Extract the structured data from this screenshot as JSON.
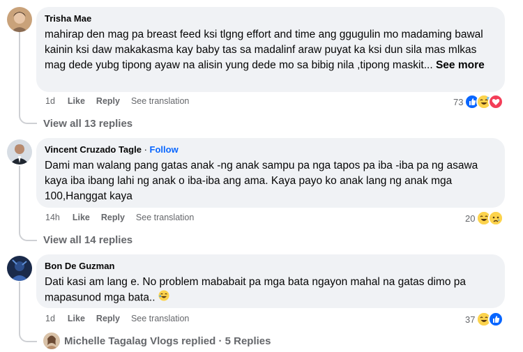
{
  "comments": [
    {
      "author": "Trisha Mae",
      "text": "mahirap den mag pa breast feed ksi tlgng effort and time ang ggugulin mo madaming bawal kainin ksi daw makakasma kay baby tas sa madalinf araw puyat ka ksi dun sila mas mlkas mag dede yubg tipong ayaw na alisin yung dede mo sa bibig nila ,tipong maskit...",
      "see_more": "See more",
      "time": "1d",
      "like": "Like",
      "reply": "Reply",
      "translate": "See translation",
      "reaction_count": "73",
      "reactions": [
        "like",
        "haha-sweat",
        "love"
      ],
      "view_replies": "View all 13 replies"
    },
    {
      "author": "Vincent Cruzado Tagle",
      "separator": "·",
      "follow": "Follow",
      "text": "Dami man walang pang gatas anak -ng anak sampu pa nga tapos pa iba -iba pa ng asawa kaya iba ibang lahi ng anak o iba-iba ang ama. Kaya payo ko anak lang ng anak mga 100,Hanggat kaya",
      "time": "14h",
      "like": "Like",
      "reply": "Reply",
      "translate": "See translation",
      "reaction_count": "20",
      "reactions": [
        "haha",
        "sad"
      ],
      "view_replies": "View all 14 replies"
    },
    {
      "author": "Bon De Guzman",
      "text": "Dati kasi am lang e. No problem mababait pa mga bata ngayon mahal na gatas dimo pa mapasunod mga bata..",
      "time": "1d",
      "like": "Like",
      "reply": "Reply",
      "translate": "See translation",
      "reaction_count": "37",
      "reactions": [
        "haha",
        "like"
      ],
      "replied_summary": "Michelle Tagalag Vlogs replied · 5 Replies"
    }
  ],
  "colors": {
    "bubble": "#f0f2f5",
    "meta": "#65676b",
    "link": "#0866ff",
    "like_blue": "#0866ff",
    "love_red": "#f33e58",
    "haha_yellow": "#fcd34d"
  }
}
